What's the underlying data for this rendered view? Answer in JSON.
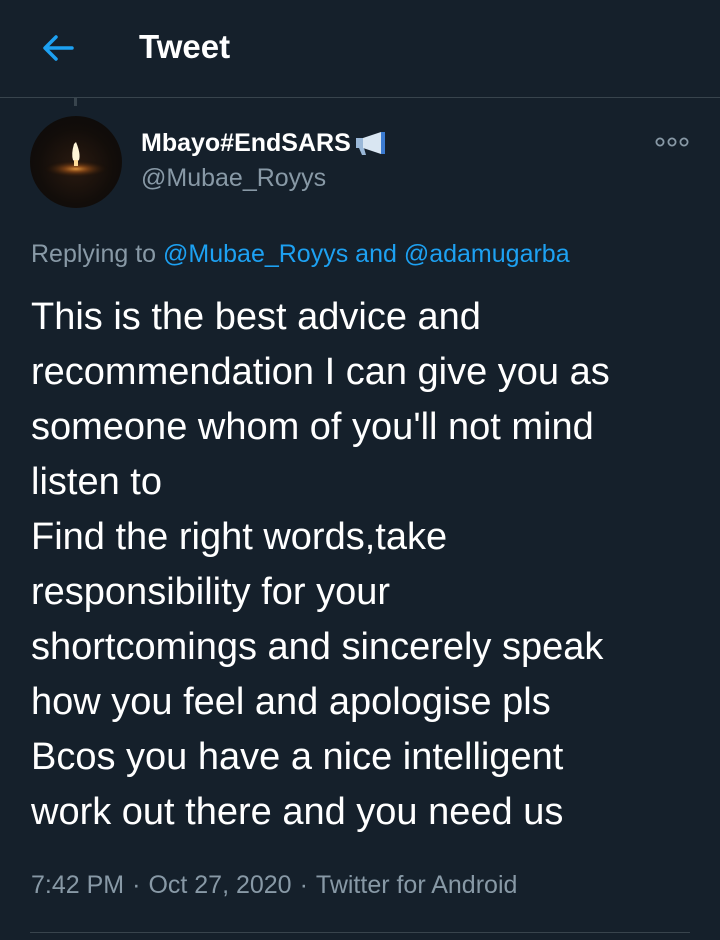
{
  "header": {
    "title": "Tweet",
    "back_icon": "arrow-left-icon"
  },
  "tweet": {
    "author": {
      "display_name": "Mbayo#EndSARS",
      "badge_icon": "megaphone-icon",
      "username": "@Mubae_Royys",
      "avatar_icon": "candle-avatar"
    },
    "more_icon": "more-options-icon",
    "reply": {
      "prefix": "Replying to",
      "mention_1": "@Mubae_Royys",
      "conjunction": "and",
      "mention_2": "@adamugarba"
    },
    "body_lines": [
      "This is the best advice and",
      "recommendation I can give you as",
      "someone whom of you'll not mind",
      "listen to",
      "Find the right words,take",
      "responsibility for your",
      "shortcomings and sincerely speak",
      "how you feel and apologise pls",
      "Bcos you have a nice intelligent",
      "work out there and you need us"
    ],
    "time": "7:42 PM",
    "separator": "·",
    "date": "Oct 27, 2020",
    "source": "Twitter for Android"
  },
  "colors": {
    "background": "#15202b",
    "accent": "#1da1f2",
    "secondary_text": "#8899a6",
    "divider": "#38444d"
  }
}
